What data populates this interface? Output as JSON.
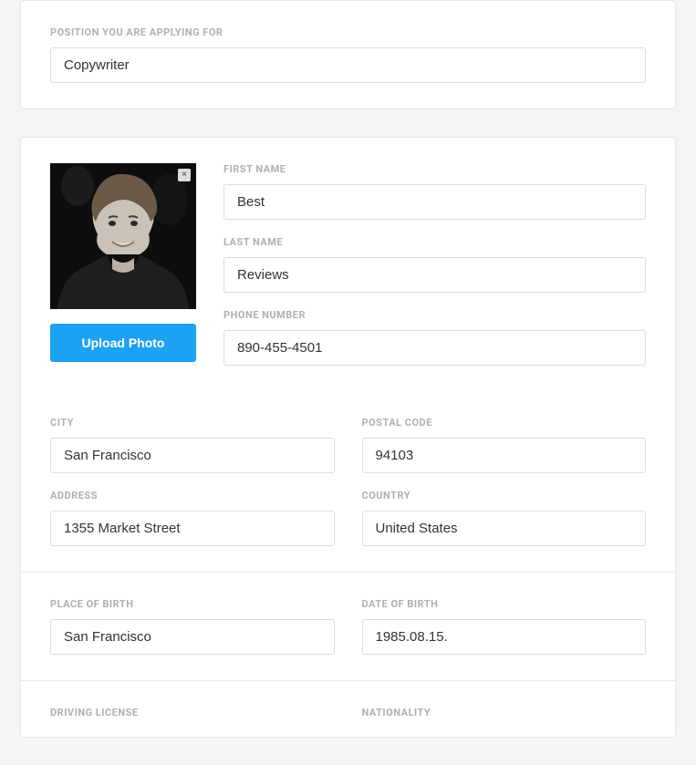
{
  "position": {
    "label": "POSITION YOU ARE APPLYING FOR",
    "value": "Copywriter"
  },
  "photo": {
    "upload_label": "Upload Photo",
    "close_label": "×"
  },
  "personal": {
    "first_name_label": "FIRST NAME",
    "first_name_value": "Best",
    "last_name_label": "LAST NAME",
    "last_name_value": "Reviews",
    "phone_label": "PHONE NUMBER",
    "phone_value": "890-455-4501"
  },
  "address": {
    "city_label": "CITY",
    "city_value": "San Francisco",
    "postal_label": "POSTAL CODE",
    "postal_value": "94103",
    "address_label": "ADDRESS",
    "address_value": "1355 Market Street",
    "country_label": "COUNTRY",
    "country_value": "United States"
  },
  "birth": {
    "place_label": "PLACE OF BIRTH",
    "place_value": "San Francisco",
    "date_label": "DATE OF BIRTH",
    "date_value": "1985.08.15."
  },
  "extra": {
    "license_label": "DRIVING LICENSE",
    "nationality_label": "NATIONALITY"
  }
}
